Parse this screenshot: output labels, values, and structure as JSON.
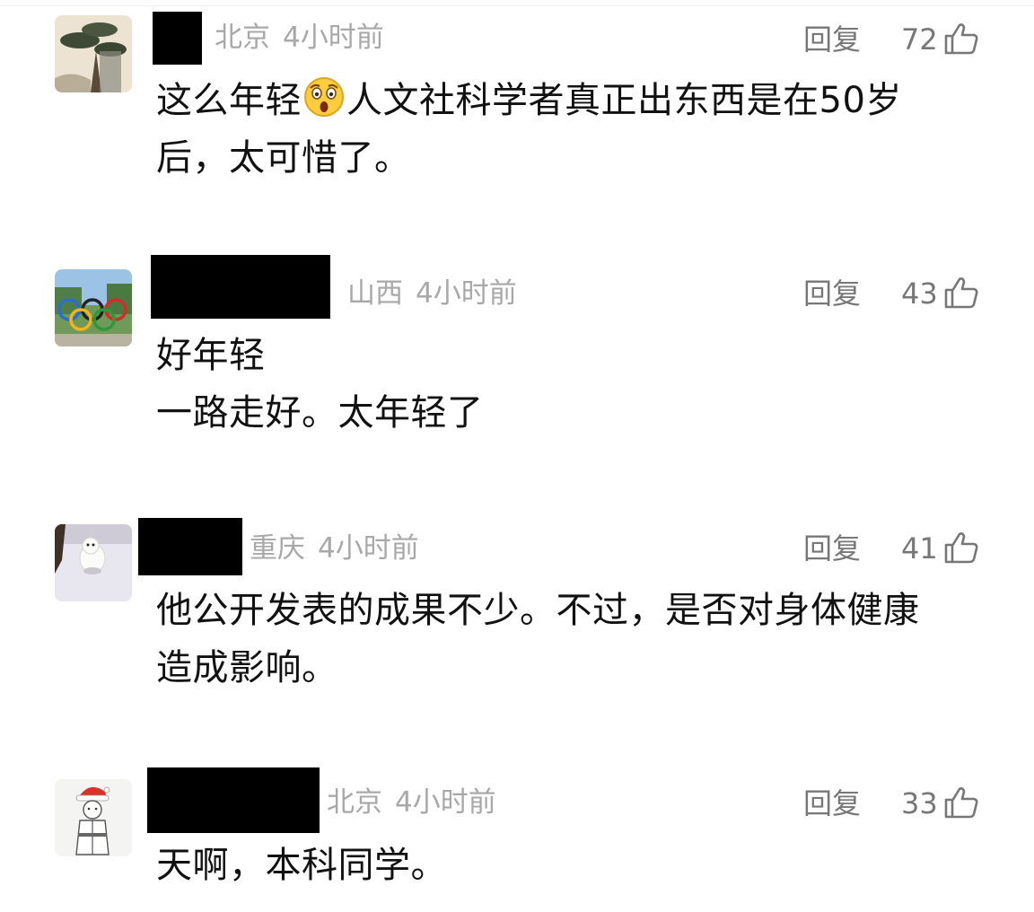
{
  "comments": [
    {
      "location": "北京",
      "time": "4小时前",
      "reply_label": "回复",
      "likes": "72",
      "text_lines": [
        "这么年轻",
        "人文社科学者真正出东西是在50岁",
        "后，太可惜了。"
      ],
      "emoji": "astonished-face-emoji"
    },
    {
      "location": "山西",
      "time": "4小时前",
      "reply_label": "回复",
      "likes": "43",
      "text_lines": [
        "好年轻",
        "一路走好。太年轻了"
      ]
    },
    {
      "location": "重庆",
      "time": "4小时前",
      "reply_label": "回复",
      "likes": "41",
      "text_lines": [
        "他公开发表的成果不少。不过，是否对身体健康",
        "造成影响。"
      ]
    },
    {
      "location": "北京",
      "time": "4小时前",
      "reply_label": "回复",
      "likes": "33",
      "text_lines": [
        "天啊，本科同学。"
      ]
    }
  ],
  "colors": {
    "meta_text": "#a8a8a8",
    "action_text": "#777777",
    "body_text": "#111111",
    "redaction": "#000000"
  },
  "icons": {
    "like": "thumbs-up-outline-icon"
  }
}
